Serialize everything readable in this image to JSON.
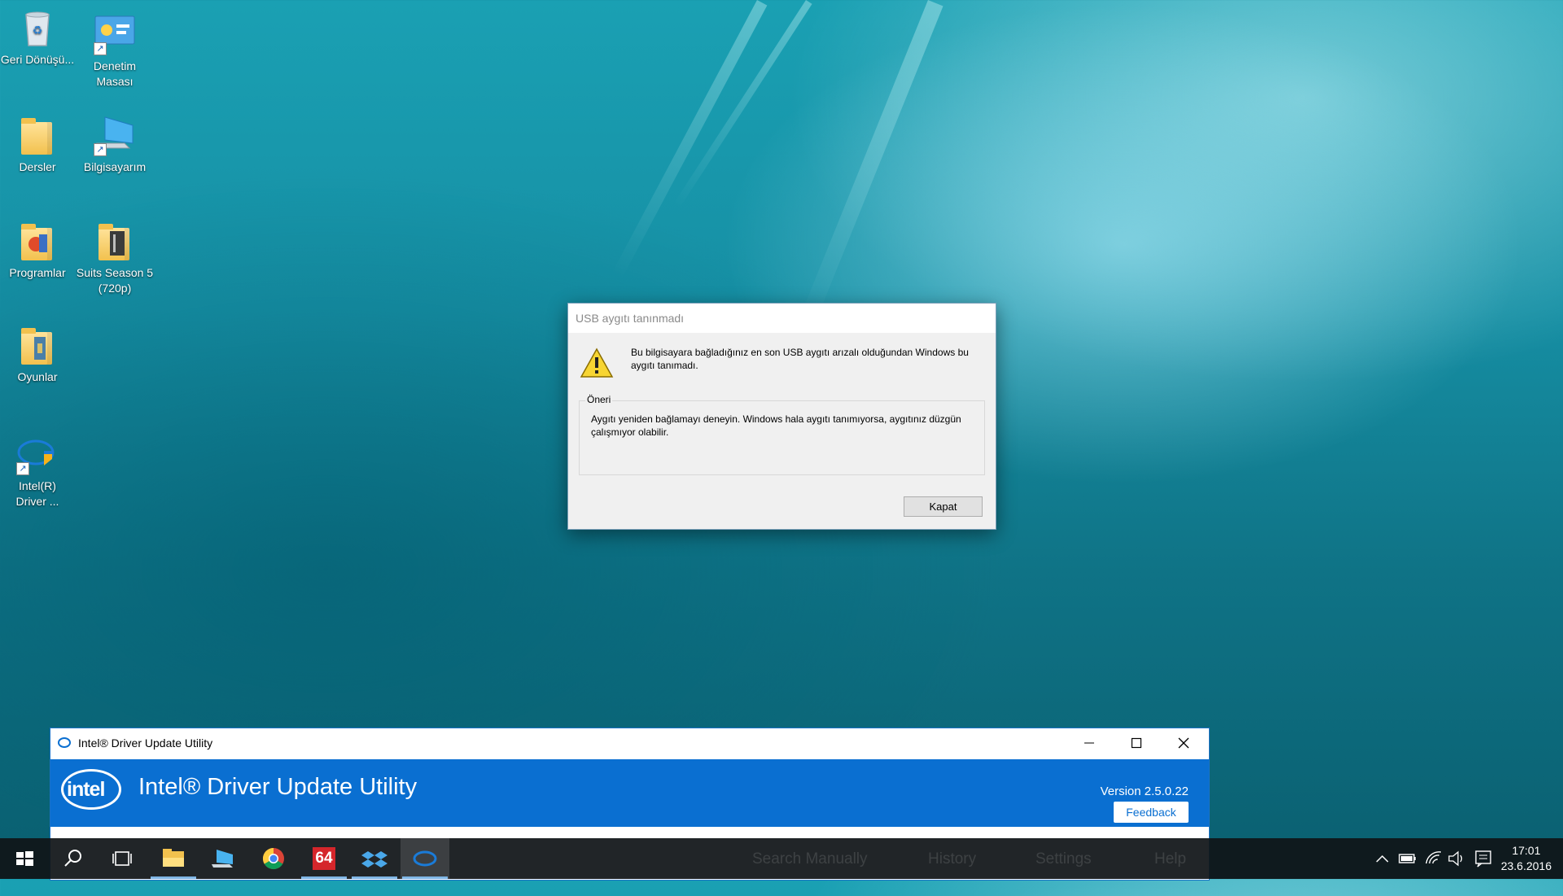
{
  "desktop": {
    "icons": [
      {
        "label": "Geri Dönüşü..."
      },
      {
        "label": "Denetim Masası"
      },
      {
        "label": "Dersler"
      },
      {
        "label": "Bilgisayarım"
      },
      {
        "label": "Programlar"
      },
      {
        "label": "Suits Season 5 (720p)"
      },
      {
        "label": "Oyunlar"
      },
      {
        "label": "Intel(R) Driver ..."
      }
    ]
  },
  "dialog": {
    "title": "USB aygıtı tanınmadı",
    "message": "Bu bilgisayara bağladığınız en son USB aygıtı arızalı olduğundan Windows bu aygıtı tanımadı.",
    "group_label": "Öneri",
    "suggestion": "Aygıtı yeniden bağlamayı deneyin. Windows hala aygıtı tanımıyorsa, aygıtınız düzgün çalışmıyor olabilir.",
    "close_label": "Kapat"
  },
  "intel_window": {
    "title": "Intel® Driver Update Utility",
    "app_title": "Intel® Driver Update Utility",
    "logo_text": "intel",
    "version_label": "Version  2.5.0.22",
    "feedback_label": "Feedback"
  },
  "taskbar": {
    "ghost_items": [
      "Search Manually",
      "History",
      "Settings",
      "Help"
    ],
    "pinned_64_label": "64",
    "time": "17:01",
    "date": "23.6.2016"
  },
  "colors": {
    "intel_blue": "#0a6fd1",
    "taskbar": "#101418"
  }
}
